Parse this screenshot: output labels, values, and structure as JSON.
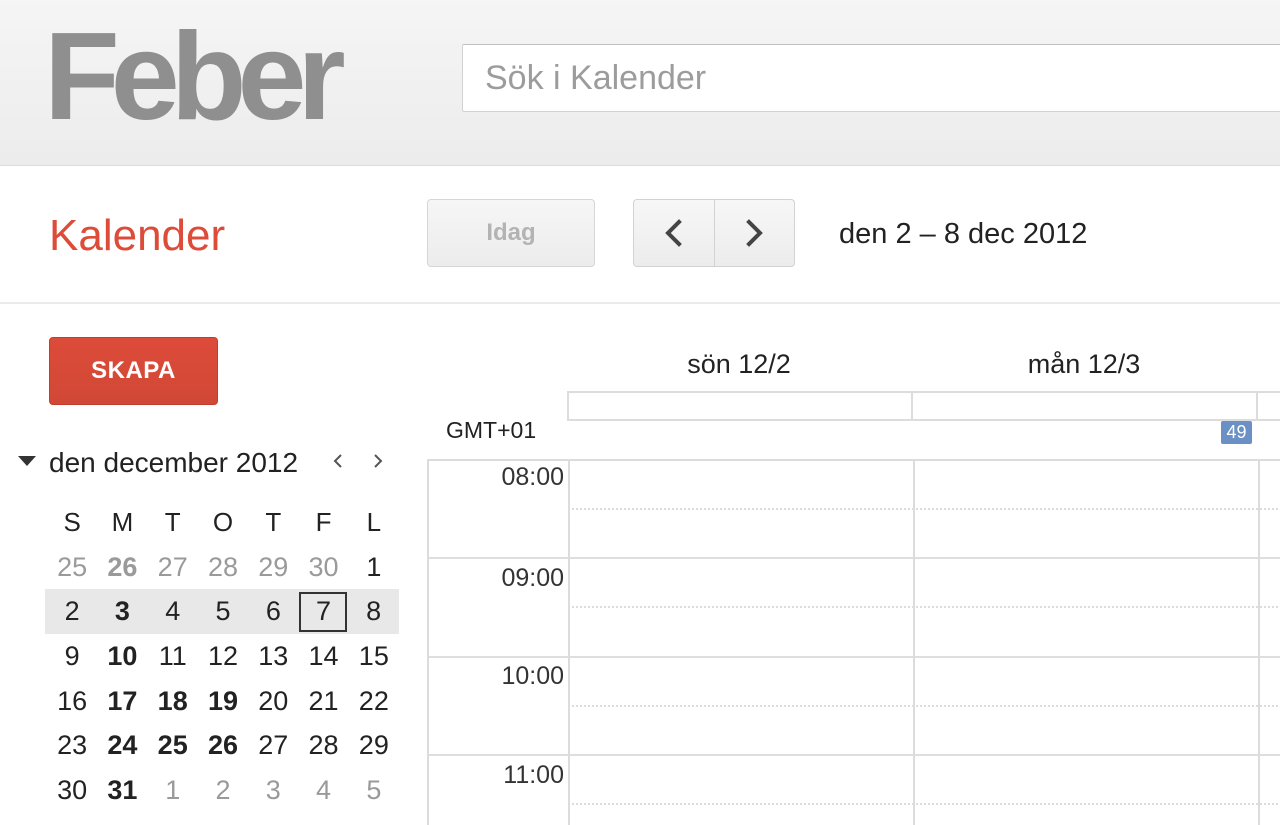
{
  "header": {
    "logo": "Feber",
    "search_placeholder": "Sök i Kalender"
  },
  "toolbar": {
    "app_title": "Kalender",
    "today_label": "Idag",
    "prev_icon": "chevron-left-icon",
    "next_icon": "chevron-right-icon",
    "date_range": "den 2 – 8 dec 2012"
  },
  "sidebar": {
    "create_label": "SKAPA",
    "mini_calendar": {
      "title": "den december 2012",
      "weekdays": [
        "S",
        "M",
        "T",
        "O",
        "T",
        "F",
        "L"
      ],
      "weeks": [
        [
          {
            "d": "25",
            "o": true
          },
          {
            "d": "26",
            "o": true,
            "b": true
          },
          {
            "d": "27",
            "o": true
          },
          {
            "d": "28",
            "o": true
          },
          {
            "d": "29",
            "o": true
          },
          {
            "d": "30",
            "o": true
          },
          {
            "d": "1"
          }
        ],
        [
          {
            "d": "2"
          },
          {
            "d": "3",
            "b": true
          },
          {
            "d": "4"
          },
          {
            "d": "5"
          },
          {
            "d": "6"
          },
          {
            "d": "7",
            "t": true
          },
          {
            "d": "8"
          }
        ],
        [
          {
            "d": "9"
          },
          {
            "d": "10",
            "b": true
          },
          {
            "d": "11"
          },
          {
            "d": "12"
          },
          {
            "d": "13"
          },
          {
            "d": "14"
          },
          {
            "d": "15"
          }
        ],
        [
          {
            "d": "16"
          },
          {
            "d": "17",
            "b": true
          },
          {
            "d": "18",
            "b": true
          },
          {
            "d": "19",
            "b": true
          },
          {
            "d": "20"
          },
          {
            "d": "21"
          },
          {
            "d": "22"
          }
        ],
        [
          {
            "d": "23"
          },
          {
            "d": "24",
            "b": true
          },
          {
            "d": "25",
            "b": true
          },
          {
            "d": "26",
            "b": true
          },
          {
            "d": "27"
          },
          {
            "d": "28"
          },
          {
            "d": "29"
          }
        ],
        [
          {
            "d": "30"
          },
          {
            "d": "31",
            "b": true
          },
          {
            "d": "1",
            "o": true
          },
          {
            "d": "2",
            "o": true
          },
          {
            "d": "3",
            "o": true
          },
          {
            "d": "4",
            "o": true
          },
          {
            "d": "5",
            "o": true
          }
        ]
      ]
    }
  },
  "calendar": {
    "days": [
      "sön 12/2",
      "mån 12/3"
    ],
    "timezone": "GMT+01",
    "week_number": "49",
    "hours": [
      "08:00",
      "09:00",
      "10:00",
      "11:00"
    ]
  },
  "colors": {
    "accent": "#dd4b39",
    "week_badge": "#6b90c5"
  }
}
